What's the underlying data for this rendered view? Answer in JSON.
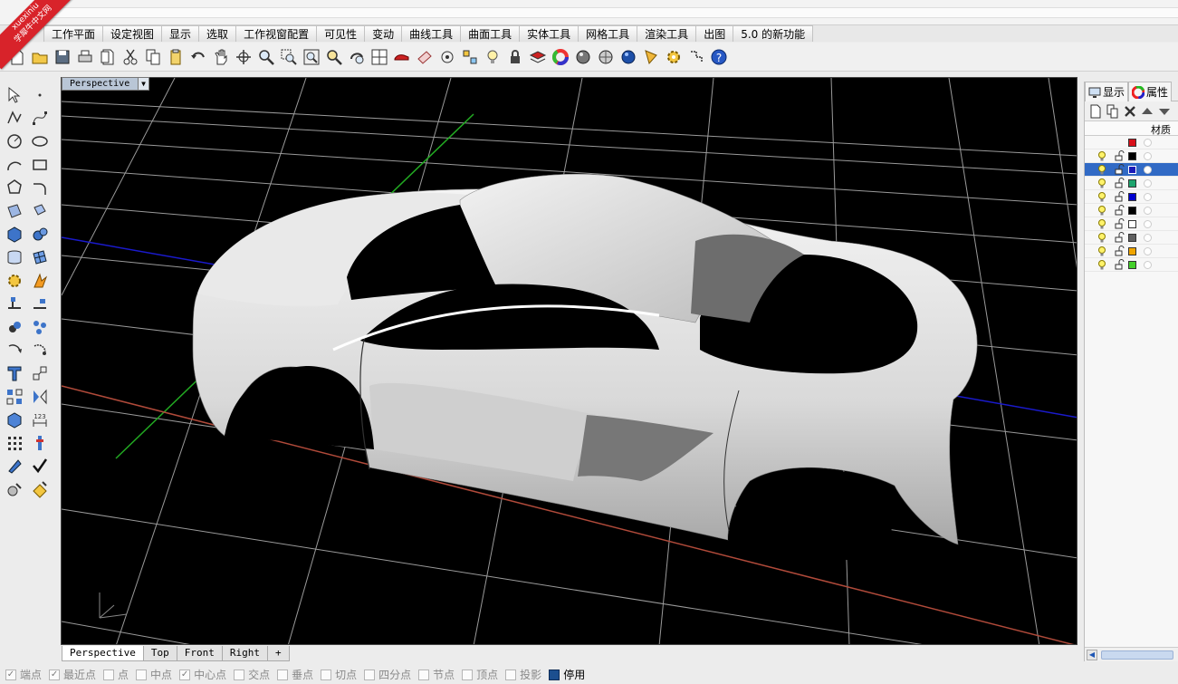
{
  "watermark": {
    "line1": "xuexiniu",
    "line2": "学犀牛中文网"
  },
  "menu_tabs": [
    "工作平面",
    "设定视图",
    "显示",
    "选取",
    "工作视窗配置",
    "可见性",
    "变动",
    "曲线工具",
    "曲面工具",
    "实体工具",
    "网格工具",
    "渲染工具",
    "出图",
    "5.0 的新功能"
  ],
  "toolbar_icons": [
    "new-document-icon",
    "open-folder-icon",
    "save-icon",
    "print-icon",
    "import-icon",
    "cut-icon",
    "copy-icon",
    "paste-icon",
    "undo-icon",
    "pan-hand-icon",
    "rotate-view-icon",
    "zoom-icon",
    "zoom-window-icon",
    "zoom-extents-icon",
    "zoom-selected-icon",
    "undo-view-icon",
    "four-viewports-icon",
    "car-shade-icon",
    "ghosted-icon",
    "rotate-cplane-icon",
    "cplane-icon",
    "light-bulb-icon",
    "lock-icon",
    "layer-icon",
    "color-wheel-icon",
    "render-sphere-icon",
    "render-preview-icon",
    "blue-sphere-icon",
    "pen-icon",
    "settings-gear-icon",
    "snap-icon",
    "help-icon"
  ],
  "viewport": {
    "title": "Perspective"
  },
  "viewport_tabs": [
    "Perspective",
    "Top",
    "Front",
    "Right",
    "+"
  ],
  "right_panel": {
    "tabs": [
      "显示",
      "属性"
    ],
    "header": "材质",
    "layers": [
      {
        "color": "#d8101a",
        "visible": false,
        "selected": false
      },
      {
        "color": "#000000",
        "visible": true,
        "selected": false
      },
      {
        "color": "#1a1ab8",
        "visible": true,
        "selected": true
      },
      {
        "color": "#1ea56e",
        "visible": true,
        "selected": false
      },
      {
        "color": "#0000d0",
        "visible": true,
        "selected": false
      },
      {
        "color": "#000000",
        "visible": true,
        "selected": false
      },
      {
        "color": "#ffffff",
        "visible": true,
        "selected": false
      },
      {
        "color": "#606060",
        "visible": true,
        "selected": false
      },
      {
        "color": "#f0a500",
        "visible": true,
        "selected": false
      },
      {
        "color": "#44d02a",
        "visible": true,
        "selected": false
      }
    ]
  },
  "snaps": [
    {
      "label": "端点",
      "checked": true,
      "active": false
    },
    {
      "label": "最近点",
      "checked": true,
      "active": false
    },
    {
      "label": "点",
      "checked": false,
      "active": false
    },
    {
      "label": "中点",
      "checked": false,
      "active": false
    },
    {
      "label": "中心点",
      "checked": true,
      "active": false
    },
    {
      "label": "交点",
      "checked": false,
      "active": false
    },
    {
      "label": "垂点",
      "checked": false,
      "active": false
    },
    {
      "label": "切点",
      "checked": false,
      "active": false
    },
    {
      "label": "四分点",
      "checked": false,
      "active": false
    },
    {
      "label": "节点",
      "checked": false,
      "active": false
    },
    {
      "label": "顶点",
      "checked": false,
      "active": false
    },
    {
      "label": "投影",
      "checked": false,
      "active": false
    },
    {
      "label": "停用",
      "checked": true,
      "active": true
    }
  ]
}
